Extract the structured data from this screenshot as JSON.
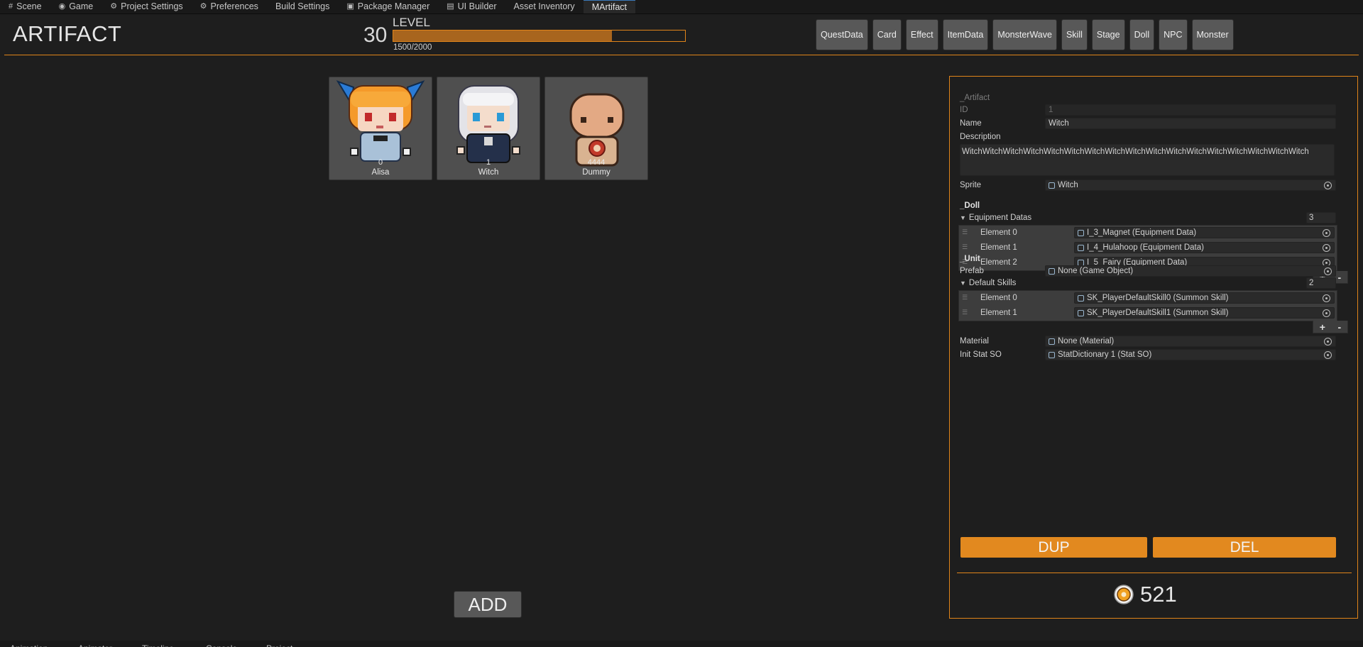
{
  "tabs": [
    {
      "label": "Scene",
      "icon": "grid-icon"
    },
    {
      "label": "Game",
      "icon": "gamepad-icon"
    },
    {
      "label": "Project Settings",
      "icon": "gear-icon"
    },
    {
      "label": "Preferences",
      "icon": "gear-icon"
    },
    {
      "label": "Build Settings",
      "icon": ""
    },
    {
      "label": "Package Manager",
      "icon": "package-icon"
    },
    {
      "label": "UI Builder",
      "icon": "ui-builder-icon"
    },
    {
      "label": "Asset Inventory",
      "icon": ""
    },
    {
      "label": "MArtifact",
      "icon": ""
    }
  ],
  "header": {
    "title": "ARTIFACT",
    "level_number": "30",
    "level_label": "LEVEL",
    "xp_text": "1500/2000",
    "xp_fraction": 0.75,
    "nav_buttons": [
      "QuestData",
      "Card",
      "Effect",
      "ItemData",
      "MonsterWave",
      "Skill",
      "Stage",
      "Doll",
      "NPC",
      "Monster"
    ]
  },
  "cards": [
    {
      "id": "0",
      "name": "Alisa"
    },
    {
      "id": "1",
      "name": "Witch"
    },
    {
      "id": "4444",
      "name": "Dummy"
    }
  ],
  "add_label": "ADD",
  "inspector": {
    "artifact_header": "_Artifact",
    "id_label": "ID",
    "id_value": "1",
    "name_label": "Name",
    "name_value": "Witch",
    "description_label": "Description",
    "description_value": "WitchWitchWitchWitchWitchWitchWitchWitchWitchWitchWitchWitchWitchWitchWitchWitchWitch",
    "sprite_label": "Sprite",
    "sprite_value": "Witch",
    "doll_header": "_Doll",
    "equipment_label": "Equipment Datas",
    "equipment_count": "3",
    "equipment": [
      {
        "label": "Element 0",
        "value": "I_3_Magnet (Equipment Data)"
      },
      {
        "label": "Element 1",
        "value": "I_4_Hulahoop (Equipment Data)"
      },
      {
        "label": "Element 2",
        "value": "I_5_Fairy (Equipment Data)"
      }
    ],
    "unit_header": "_Unit",
    "prefab_label": "Prefab",
    "prefab_value": "None (Game Object)",
    "skills_label": "Default Skills",
    "skills_count": "2",
    "skills": [
      {
        "label": "Element 0",
        "value": "SK_PlayerDefaultSkill0 (Summon Skill)"
      },
      {
        "label": "Element 1",
        "value": "SK_PlayerDefaultSkill1 (Summon Skill)"
      }
    ],
    "material_label": "Material",
    "material_value": "None (Material)",
    "init_stat_label": "Init Stat SO",
    "init_stat_value": "StatDictionary 1 (Stat SO)",
    "plus": "+",
    "minus": "-"
  },
  "dup_label": "DUP",
  "del_label": "DEL",
  "coins": "521",
  "bottom_tabs": [
    "Animation",
    "Animator",
    "Timeline",
    "Console",
    "Project"
  ],
  "colors": {
    "accent": "#e0841a",
    "button": "#585858",
    "xp_fill": "#a8651e"
  }
}
